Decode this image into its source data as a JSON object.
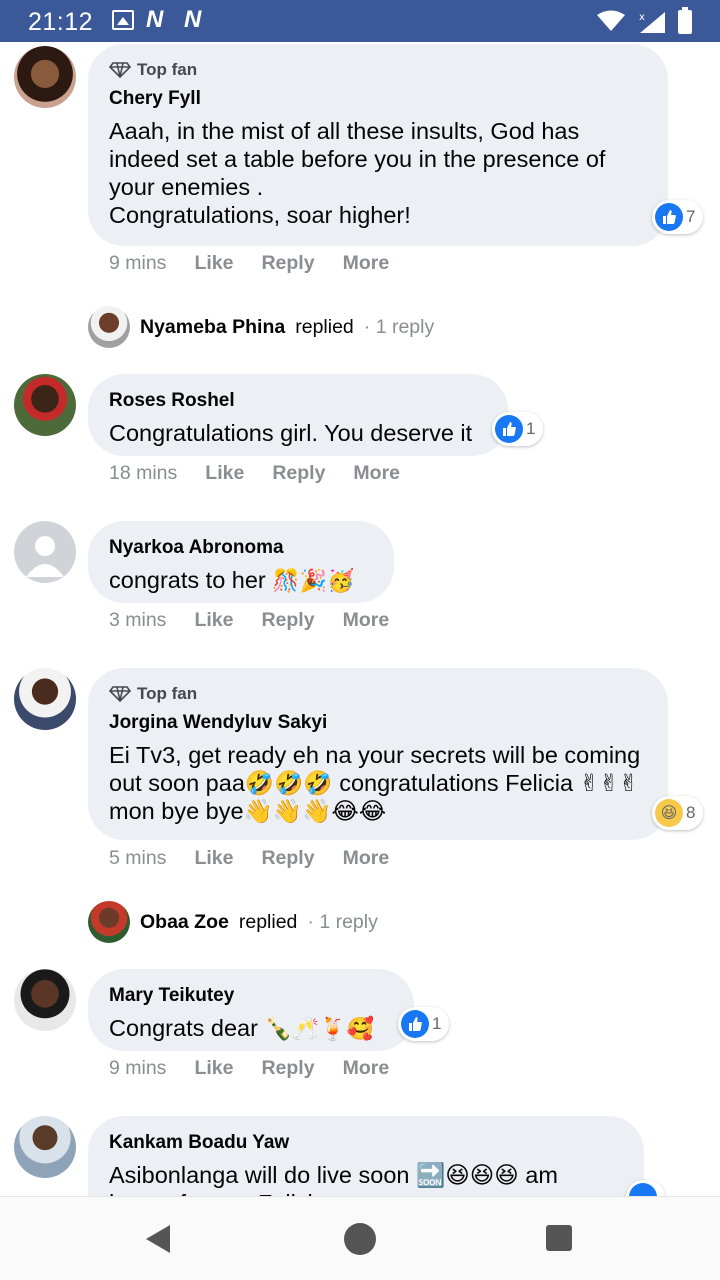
{
  "status_bar": {
    "time": "21:12",
    "n1": "N",
    "n2": "N",
    "icons": [
      "gallery-icon",
      "wifi-icon",
      "signal-icon",
      "battery-icon"
    ]
  },
  "comments": [
    {
      "badge": "Top fan",
      "author": "Chery Fyll",
      "text": "Aaah, in the mist of all these insults, God has indeed set a table before you in the presence of your enemies .\nCongratulations, soar higher!",
      "time": "9 mins",
      "like": "Like",
      "reply": "Reply",
      "more": "More",
      "reaction_count": "7"
    },
    {
      "author": "Roses Roshel",
      "text": "Congratulations girl. You deserve it",
      "time": "18 mins",
      "like": "Like",
      "reply": "Reply",
      "more": "More",
      "reaction_count": "1"
    },
    {
      "author": "Nyarkoa Abronoma",
      "text": "congrats to her",
      "emojis": "🎊🎉🥳",
      "time": "3 mins",
      "like": "Like",
      "reply": "Reply",
      "more": "More"
    },
    {
      "badge": "Top fan",
      "author": "Jorgina Wendyluv Sakyi",
      "text": "Ei Tv3, get ready eh na your secrets will be coming out soon paa🤣🤣🤣 congratulations Felicia ✌✌✌mon bye bye👋👋👋😂😂",
      "time": "5 mins",
      "like": "Like",
      "reply": "Reply",
      "more": "More",
      "reaction_count": "8"
    },
    {
      "author": "Mary Teikutey",
      "text": "Congrats dear",
      "emojis": "🍾🥂🍹🥰",
      "time": "9 mins",
      "like": "Like",
      "reply": "Reply",
      "more": "More",
      "reaction_count": "1"
    },
    {
      "author": "Kankam Boadu Yaw",
      "text": "Asibonlanga will do live soon 🔜😆😆😆 am happy for you Felicia"
    }
  ],
  "reply_rows": [
    {
      "name": "Nyameba Phina",
      "verb": "replied",
      "count": "· 1 reply"
    },
    {
      "name": "Obaa Zoe",
      "verb": "replied",
      "count": "· 1 reply"
    }
  ],
  "colors": {
    "status_bar": "#3b5998",
    "bubble": "#eceff4",
    "like_blue": "#1877f2",
    "muted": "#8a8d91"
  }
}
